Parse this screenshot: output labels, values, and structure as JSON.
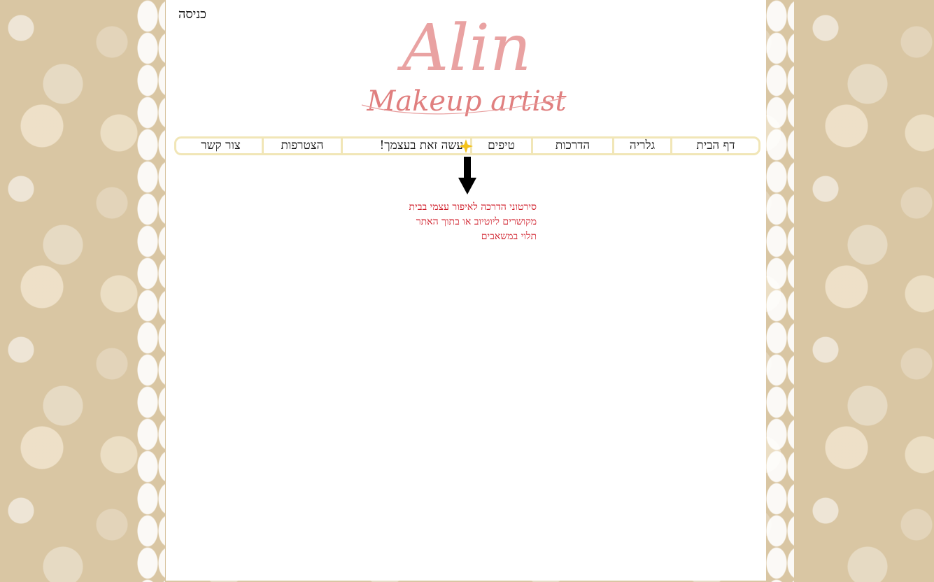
{
  "header": {
    "login_label": "כניסה",
    "logo_name": "Alin",
    "logo_subtitle": "Makeup artist"
  },
  "nav": {
    "items": [
      {
        "label": "דף הבית"
      },
      {
        "label": "גלריה"
      },
      {
        "label": "הדרכות"
      },
      {
        "label": "טיפים"
      },
      {
        "label": "עשה זאת בעצמך!"
      },
      {
        "label": "הצטרפות"
      },
      {
        "label": "צור קשר"
      }
    ]
  },
  "note": {
    "line1": "סירטוני הדרכה לאיפור עצמי בבית",
    "line2": "מקושרים ליוטיוב או בתוך האתר",
    "line3": "תלוי במשאבים"
  },
  "colors": {
    "background": "#d9c6a3",
    "page": "#ffffff",
    "nav_border": "#f1e6b7",
    "logo_pink": "#e89b9b",
    "note_red": "#d0202c",
    "star_yellow": "#f4c21a"
  },
  "icons": {
    "star": "star-icon",
    "arrow": "arrow-down-icon"
  }
}
